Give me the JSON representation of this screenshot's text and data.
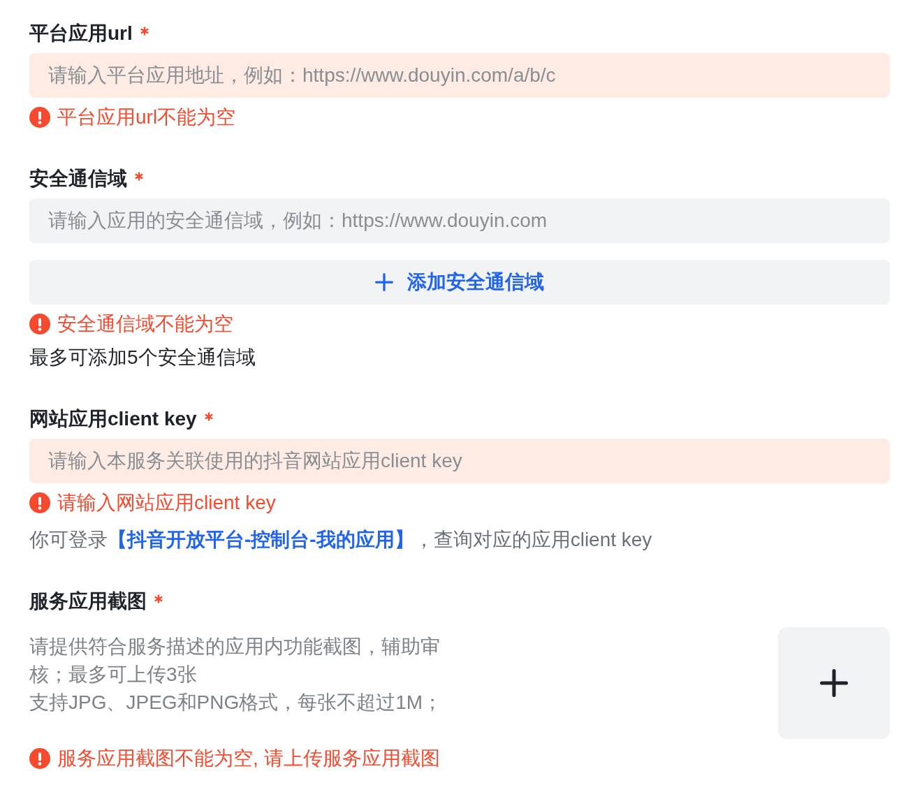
{
  "fields": [
    {
      "kind": "input",
      "label": "平台应用url",
      "required": true,
      "input": {
        "placeholder": "请输入平台应用地址，例如：https://www.douyin.com/a/b/c",
        "error": true
      },
      "error_message": "平台应用url不能为空"
    },
    {
      "kind": "input",
      "label": "安全通信域",
      "required": true,
      "input": {
        "placeholder": "请输入应用的安全通信域，例如：https://www.douyin.com",
        "error": false
      },
      "add_button": {
        "label": "添加安全通信域"
      },
      "error_message": "安全通信域不能为空",
      "note": "最多可添加5个安全通信域"
    },
    {
      "kind": "input",
      "label": "网站应用client key",
      "required": true,
      "input": {
        "placeholder": "请输入本服务关联使用的抖音网站应用client key",
        "error": true
      },
      "error_message": "请输入网站应用client key",
      "help": [
        {
          "kind": "text",
          "text": "你可登录"
        },
        {
          "kind": "link",
          "text": "【抖音开放平台-控制台-我的应用】"
        },
        {
          "kind": "text",
          "text": "，查询对应的应用client key"
        }
      ]
    },
    {
      "kind": "upload",
      "label": "服务应用截图",
      "required": true,
      "description": [
        "请提供符合服务描述的应用内功能截图，辅助审核；最多可上传3张",
        "支持JPG、JPEG和PNG格式，每张不超过1M；"
      ],
      "error_message": "服务应用截图不能为空, 请上传服务应用截图"
    }
  ]
}
